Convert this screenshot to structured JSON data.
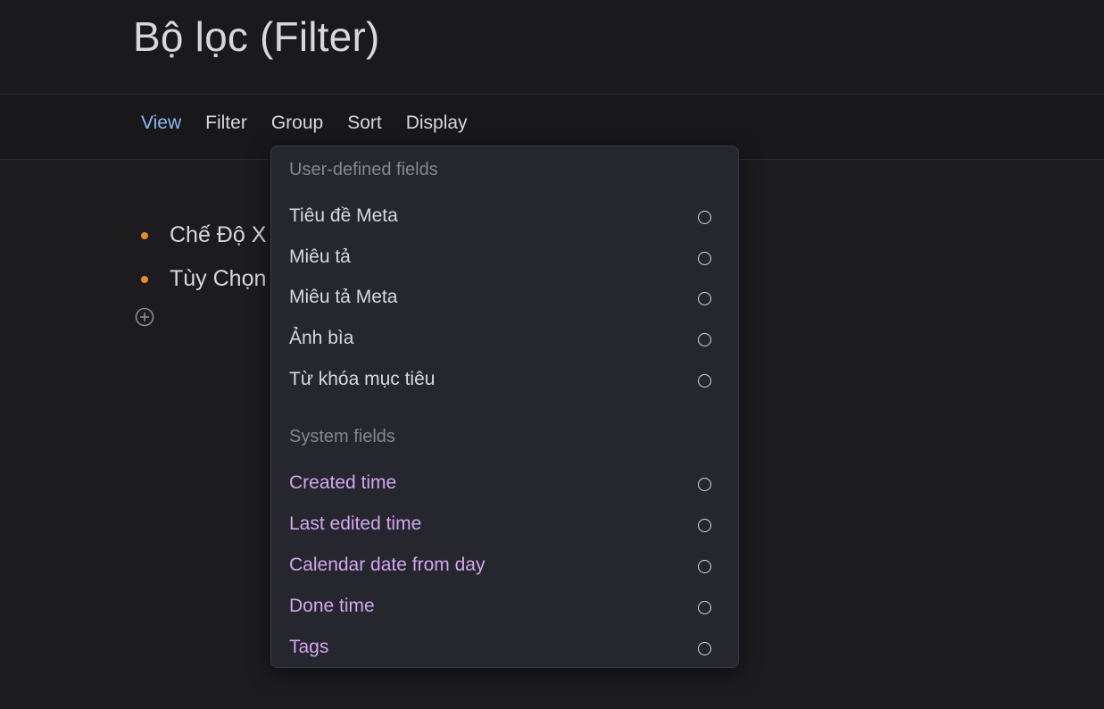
{
  "page": {
    "title": "Bộ lọc (Filter)"
  },
  "toolbar": {
    "tabs": [
      {
        "label": "View",
        "active": true
      },
      {
        "label": "Filter",
        "active": false
      },
      {
        "label": "Group",
        "active": false
      },
      {
        "label": "Sort",
        "active": false
      },
      {
        "label": "Display",
        "active": false
      }
    ]
  },
  "content": {
    "items": [
      {
        "label": "Chế Độ X"
      },
      {
        "label": "Tùy Chọn"
      }
    ],
    "add_icon": "plus-circle-icon"
  },
  "dropdown": {
    "user_section_label": "User-defined fields",
    "user_fields": [
      {
        "label": "Tiêu đề Meta",
        "selected": false
      },
      {
        "label": "Miêu tả",
        "selected": false
      },
      {
        "label": "Miêu tả Meta",
        "selected": false
      },
      {
        "label": "Ảnh bìa",
        "selected": false
      },
      {
        "label": "Từ khóa mục tiêu",
        "selected": false
      }
    ],
    "system_section_label": "System fields",
    "system_fields": [
      {
        "label": "Created time",
        "selected": false
      },
      {
        "label": "Last edited time",
        "selected": false
      },
      {
        "label": "Calendar date from day",
        "selected": false
      },
      {
        "label": "Done time",
        "selected": false
      },
      {
        "label": "Tags",
        "selected": false
      }
    ]
  },
  "colors": {
    "background": "#1a1a1d",
    "accent_tab": "#8fb8f0",
    "bullet": "#e58a2b",
    "system_field": "#d3a6ee",
    "menu_bg": "#26262e"
  }
}
